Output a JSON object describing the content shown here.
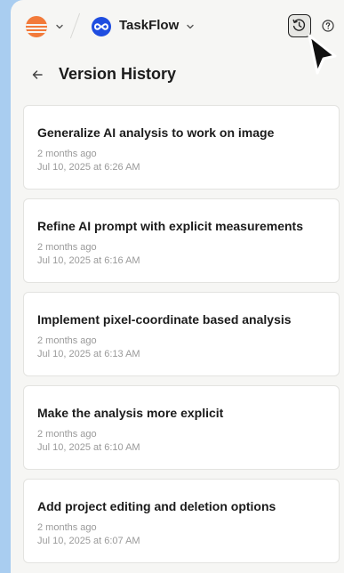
{
  "header": {
    "project_name": "TaskFlow"
  },
  "page": {
    "title": "Version History"
  },
  "versions": [
    {
      "title": "Generalize AI analysis to work on image",
      "relative": "2 months ago",
      "date": "Jul 10, 2025 at 6:26 AM"
    },
    {
      "title": "Refine AI prompt with explicit measurements",
      "relative": "2 months ago",
      "date": "Jul 10, 2025 at 6:16 AM"
    },
    {
      "title": "Implement pixel-coordinate based analysis",
      "relative": "2 months ago",
      "date": "Jul 10, 2025 at 6:13 AM"
    },
    {
      "title": "Make the analysis more explicit",
      "relative": "2 months ago",
      "date": "Jul 10, 2025 at 6:10 AM"
    },
    {
      "title": "Add project editing and deletion options",
      "relative": "2 months ago",
      "date": "Jul 10, 2025 at 6:07 AM"
    }
  ],
  "icons": {
    "org": "org-logo-icon",
    "project": "project-logo-icon",
    "history": "history-icon",
    "help": "help-icon",
    "back": "arrow-left-icon",
    "cursor": "mouse-cursor-icon"
  },
  "colors": {
    "background": "#a9cdf0",
    "panel": "#f6f6f4",
    "org_accent": "#f27a3a",
    "project_accent": "#1f4de0"
  }
}
